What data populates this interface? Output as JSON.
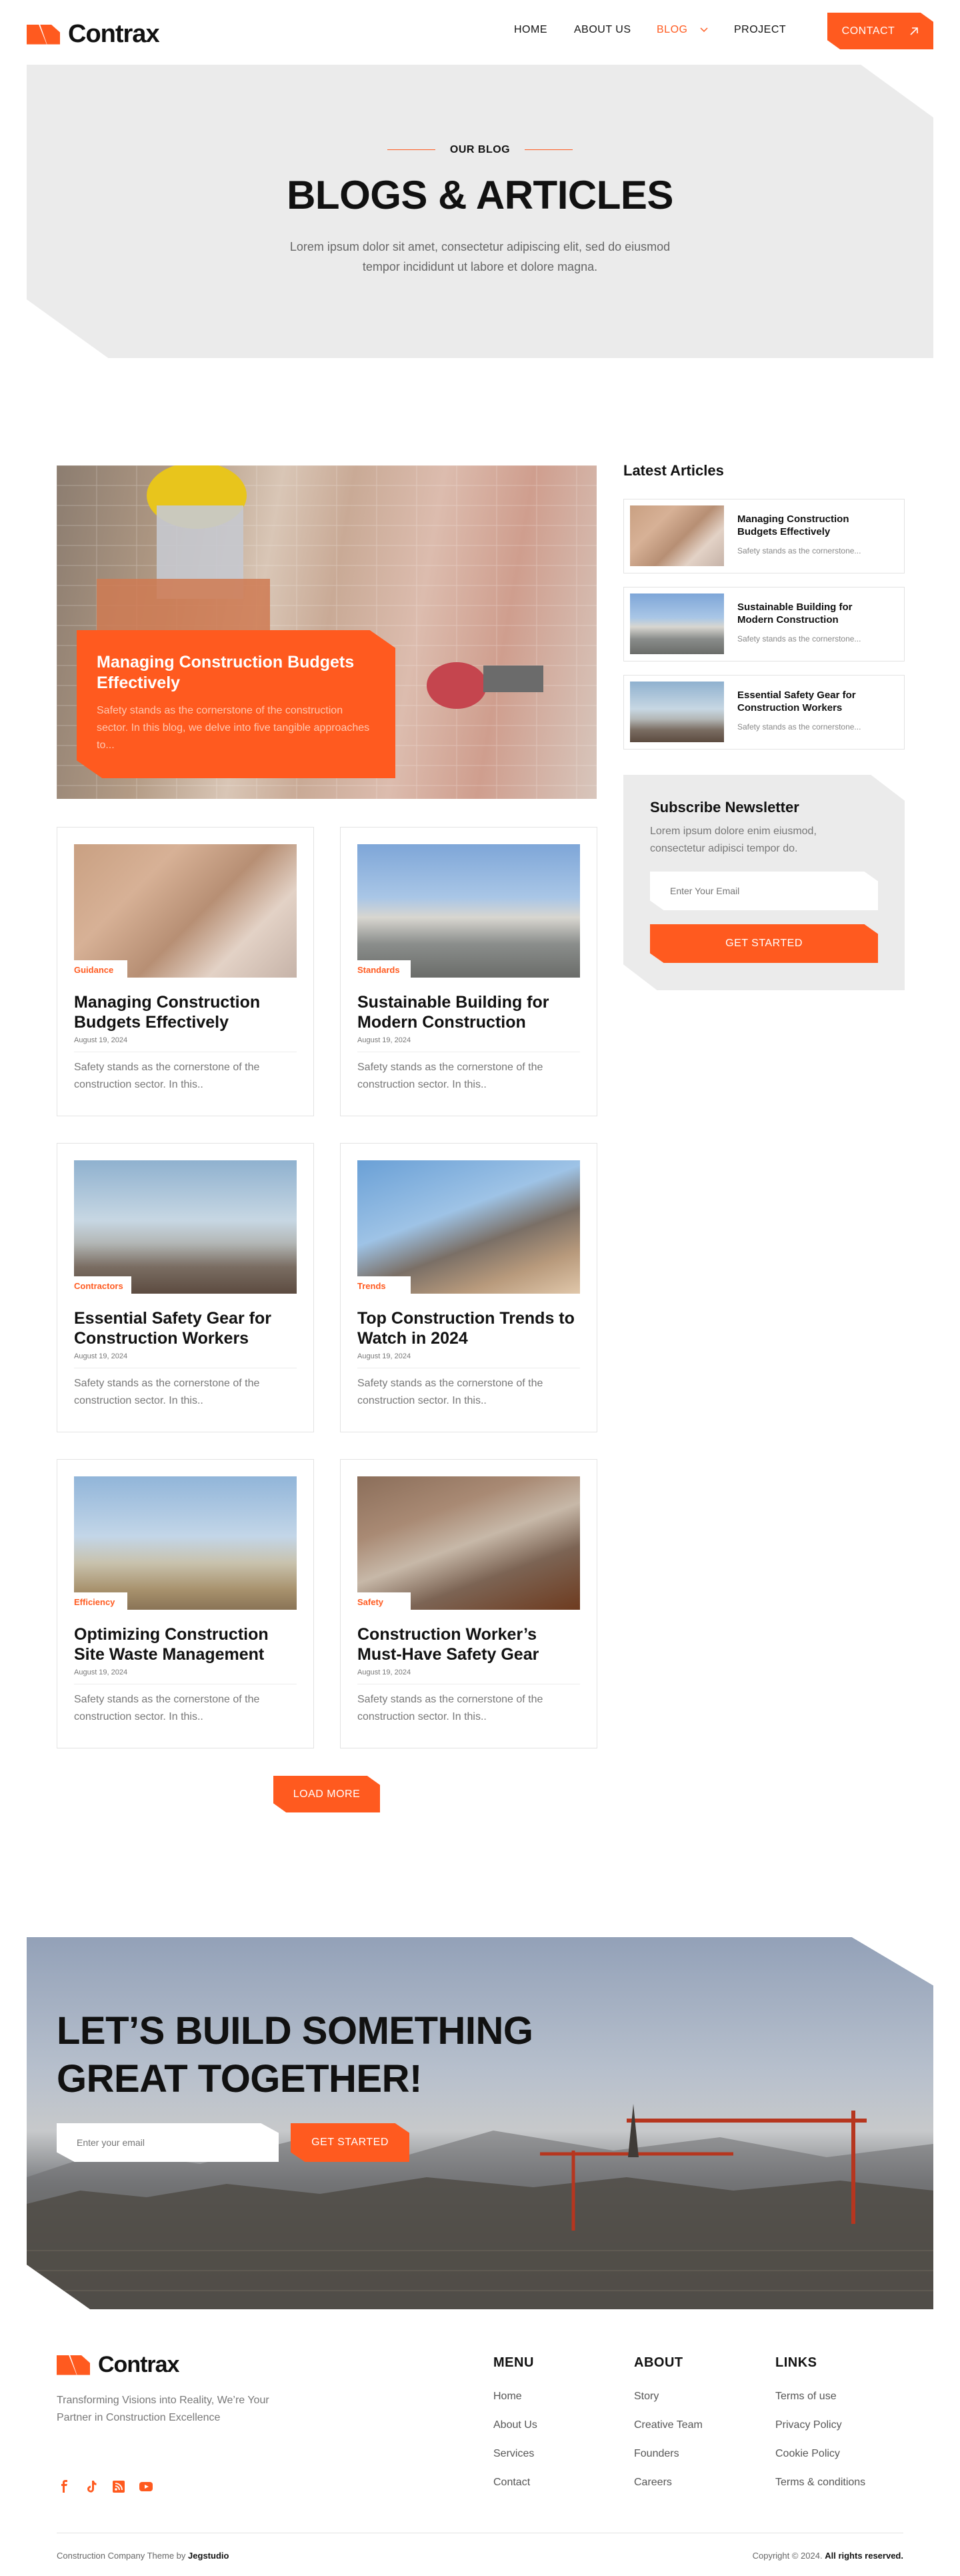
{
  "brand": {
    "name": "Contrax",
    "accent": "#ff5a1f"
  },
  "nav": {
    "items": [
      "HOME",
      "ABOUT US",
      "BLOG",
      "PROJECT"
    ],
    "active": "BLOG",
    "contact_label": "CONTACT"
  },
  "hero": {
    "eyebrow": "OUR BLOG",
    "title": "BLOGS & ARTICLES",
    "subtitle": "Lorem ipsum dolor sit amet, consectetur adipiscing elit, sed do eiusmod tempor incididunt ut labore et dolore magna."
  },
  "featured": {
    "title": "Managing Construction Budgets Effectively",
    "excerpt": "Safety stands as the cornerstone of the construction sector. In this blog, we delve into five tangible approaches to..."
  },
  "posts": [
    {
      "tag": "Guidance",
      "title": "Managing Construction Budgets Effectively",
      "date": "August 19, 2024",
      "excerpt": "Safety stands as the cornerstone of the construction sector. In this.."
    },
    {
      "tag": "Standards",
      "title": "Sustainable Building for Modern Construction",
      "date": "August 19, 2024",
      "excerpt": "Safety stands as the cornerstone of the construction sector. In this.."
    },
    {
      "tag": "Contractors",
      "title": "Essential Safety Gear for Construction Workers",
      "date": "August 19, 2024",
      "excerpt": "Safety stands as the cornerstone of the construction sector. In this.."
    },
    {
      "tag": "Trends",
      "title": "Top Construction Trends to Watch in 2024",
      "date": "August 19, 2024",
      "excerpt": "Safety stands as the cornerstone of the construction sector. In this.."
    },
    {
      "tag": "Efficiency",
      "title": "Optimizing Construction Site Waste Management",
      "date": "August 19, 2024",
      "excerpt": "Safety stands as the cornerstone of the construction sector. In this.."
    },
    {
      "tag": "Safety",
      "title": "Construction Worker’s Must-Have Safety Gear",
      "date": "August 19, 2024",
      "excerpt": "Safety stands as the cornerstone of the construction sector. In this.."
    }
  ],
  "load_more": "LOAD MORE",
  "sidebar": {
    "latest_heading": "Latest Articles",
    "latest": [
      {
        "title": "Managing Construction Budgets Effectively",
        "excerpt": "Safety stands as the cornerstone..."
      },
      {
        "title": "Sustainable Building for Modern Construction",
        "excerpt": "Safety stands as the cornerstone..."
      },
      {
        "title": "Essential Safety Gear for Construction Workers",
        "excerpt": "Safety stands as the cornerstone..."
      }
    ],
    "newsletter": {
      "title": "Subscribe Newsletter",
      "text": "Lorem ipsum dolore enim eiusmod, consectetur adipisci tempor do.",
      "placeholder": "Enter Your Email",
      "button": "GET STARTED"
    }
  },
  "cta": {
    "title_line1": "LET’S BUILD SOMETHING",
    "title_line2": "GREAT TOGETHER!",
    "placeholder": "Enter your email",
    "button": "GET STARTED"
  },
  "footer": {
    "tagline": "Transforming Visions into Reality, We’re Your Partner in Construction Excellence",
    "menu": {
      "heading": "MENU",
      "links": [
        "Home",
        "About Us",
        "Services",
        "Contact"
      ]
    },
    "about": {
      "heading": "ABOUT",
      "links": [
        "Story",
        "Creative Team",
        "Founders",
        "Careers"
      ]
    },
    "links": {
      "heading": "LINKS",
      "links": [
        "Terms of use",
        "Privacy Policy",
        "Cookie Policy",
        "Terms & conditions"
      ]
    },
    "credit_prefix": "Construction Company Theme by",
    "credit_brand": "Jegstudio",
    "copyright_prefix": "Copyright © 2024.",
    "copyright_rest": "All rights reserved."
  }
}
